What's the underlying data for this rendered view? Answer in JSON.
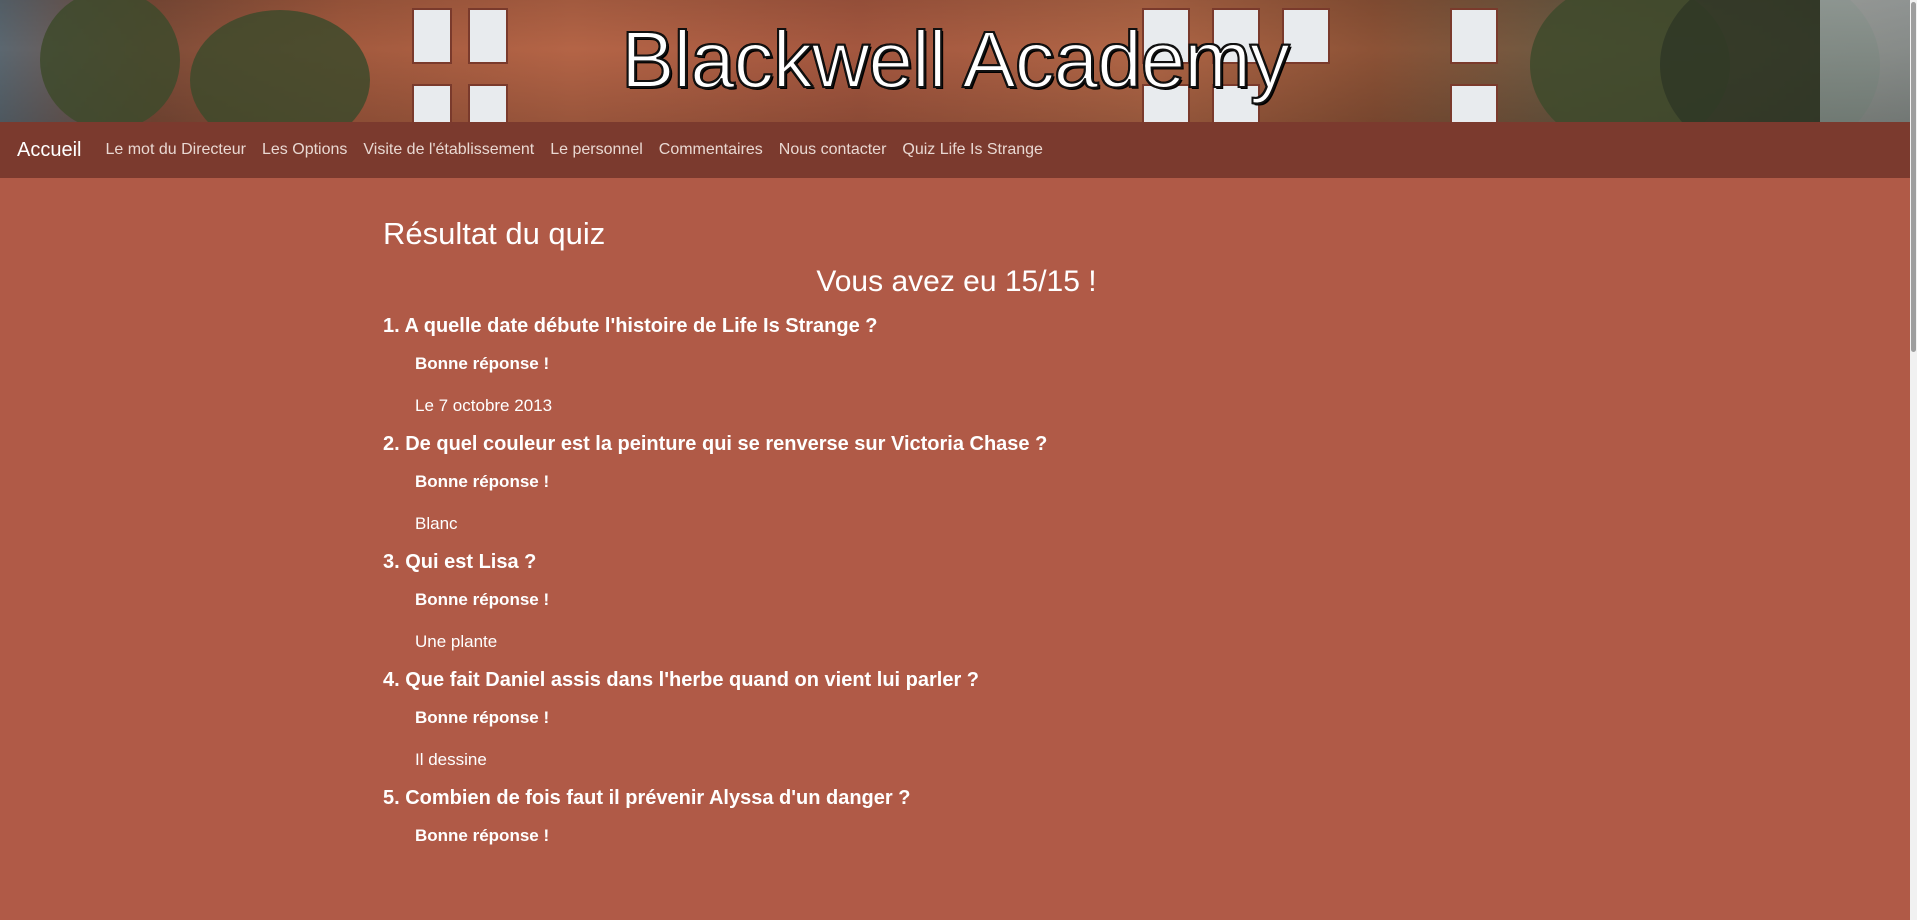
{
  "site": {
    "title": "Blackwell Academy"
  },
  "nav": {
    "brand": "Accueil",
    "links": [
      "Le mot du Directeur",
      "Les Options",
      "Visite de l'établissement",
      "Le personnel",
      "Commentaires",
      "Nous contacter",
      "Quiz Life Is Strange"
    ]
  },
  "colors": {
    "page_background": "#b05a47",
    "navbar_background": "#7b3a2e",
    "text": "#ffffff"
  },
  "main": {
    "heading": "Résultat du quiz",
    "score": "Vous avez eu 15/15 !",
    "results": [
      {
        "question": "1. A quelle date débute l'histoire de Life Is Strange ?",
        "verdict": "Bonne réponse !",
        "answer": "Le 7 octobre 2013"
      },
      {
        "question": "2. De quel couleur est la peinture qui se renverse sur Victoria Chase ?",
        "verdict": "Bonne réponse !",
        "answer": "Blanc"
      },
      {
        "question": "3. Qui est Lisa ?",
        "verdict": "Bonne réponse !",
        "answer": "Une plante"
      },
      {
        "question": "4. Que fait Daniel assis dans l'herbe quand on vient lui parler ?",
        "verdict": "Bonne réponse !",
        "answer": "Il dessine"
      },
      {
        "question": "5. Combien de fois faut il prévenir Alyssa d'un danger ?",
        "verdict": "Bonne réponse !",
        "answer": ""
      }
    ]
  }
}
